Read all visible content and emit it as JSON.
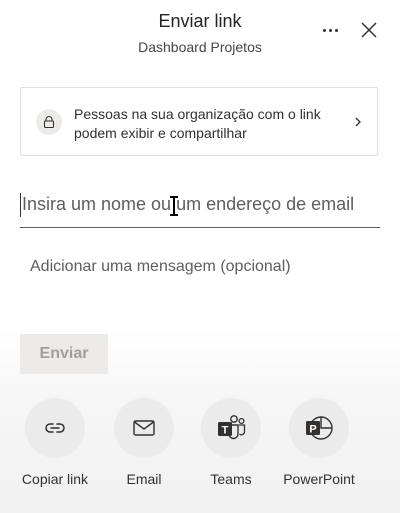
{
  "header": {
    "title": "Enviar link",
    "subtitle": "Dashboard Projetos"
  },
  "link_settings": {
    "text": "Pessoas na sua organização com o link podem exibir e compartilhar"
  },
  "recipient_input": {
    "placeholder": "Insira um nome ou um endereço de email"
  },
  "message_field": {
    "placeholder": "Adicionar uma mensagem (opcional)"
  },
  "send_button": {
    "label": "Enviar"
  },
  "share_options": [
    {
      "label": "Copiar link",
      "icon": "link-icon"
    },
    {
      "label": "Email",
      "icon": "mail-icon"
    },
    {
      "label": "Teams",
      "icon": "teams-icon"
    },
    {
      "label": "PowerPoint",
      "icon": "powerpoint-icon"
    }
  ]
}
